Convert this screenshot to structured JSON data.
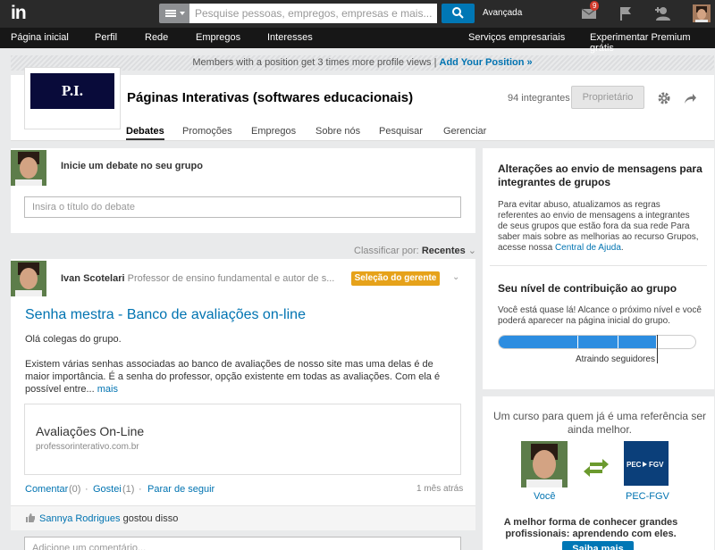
{
  "topbar": {
    "logo": "in",
    "search_placeholder": "Pesquise pessoas, empregos, empresas e mais...",
    "advanced_label": "Avançada",
    "messages_badge": "9"
  },
  "navbar": {
    "items": [
      "Página inicial",
      "Perfil",
      "Rede",
      "Empregos",
      "Interesses"
    ],
    "right_items": [
      "Serviços empresariais",
      "Experimentar Premium grátis"
    ]
  },
  "promo": {
    "text": "Members with a position get 3 times more profile views |",
    "link": "Add Your Position »"
  },
  "group": {
    "logo_text": "P.I.",
    "title": "Páginas Interativas (softwares educacionais)",
    "members": "94 integrantes",
    "owner_button": "Proprietário",
    "tabs": [
      "Debates",
      "Promoções",
      "Empregos",
      "Sobre nós",
      "Pesquisar",
      "Gerenciar"
    ]
  },
  "composer": {
    "prompt": "Inicie um debate no seu grupo",
    "title_placeholder": "Insira o título do debate"
  },
  "sort": {
    "label": "Classificar por:",
    "value": "Recentes"
  },
  "post": {
    "author": "Ivan Scotelari",
    "headline": "Professor de ensino fundamental e autor de s...",
    "badge": "Seleção do gerente",
    "title": "Senha mestra - Banco de avaliações on-line",
    "greeting": "Olá colegas do grupo.",
    "body": "Existem várias senhas associadas ao banco de avaliações de nosso site mas uma delas é de maior importância. É a senha do professor, opção existente em todas as avaliações. Com ela é possível entre...",
    "more": "mais",
    "link_title": "Avaliações On-Line",
    "link_url": "professorinterativo.com.br",
    "comment_label": "Comentar",
    "comment_count": "(0)",
    "like_label": "Gostei",
    "like_count": "(1)",
    "unfollow_label": "Parar de seguir",
    "time": "1 mês atrás",
    "liker": "Sannya Rodrigues",
    "liked_text": "gostou disso",
    "comment_placeholder": "Adicione um comentário..."
  },
  "sidebar": {
    "notice_title": "Alterações ao envio de mensagens para integrantes de grupos",
    "notice_text": "Para evitar abuso, atualizamos as regras referentes ao envio de mensagens a integrantes de seus grupos que estão fora da sua rede Para saber mais sobre as melhorias ao recurso Grupos, acesse nossa",
    "notice_link": "Central de Ajuda",
    "contrib_title": "Seu nível de contribuição ao grupo",
    "contrib_text": "Você está quase lá! Alcance o próximo nível e você poderá aparecer na página inicial do grupo.",
    "contrib_progress": 0.8,
    "contrib_label": "Atraindo seguidores"
  },
  "ad": {
    "headline": "Um curso para quem já é uma referência ser ainda melhor.",
    "you_label": "Você",
    "partner_label": "PEC-FGV",
    "partner_logo": "PEC ▶ FGV",
    "cta": "A melhor forma de conhecer grandes profissionais: aprendendo com eles.",
    "button": "Saiba mais"
  },
  "colors": {
    "brand": "#0077b5",
    "badge": "#e6a21a",
    "link": "#0073b1"
  }
}
